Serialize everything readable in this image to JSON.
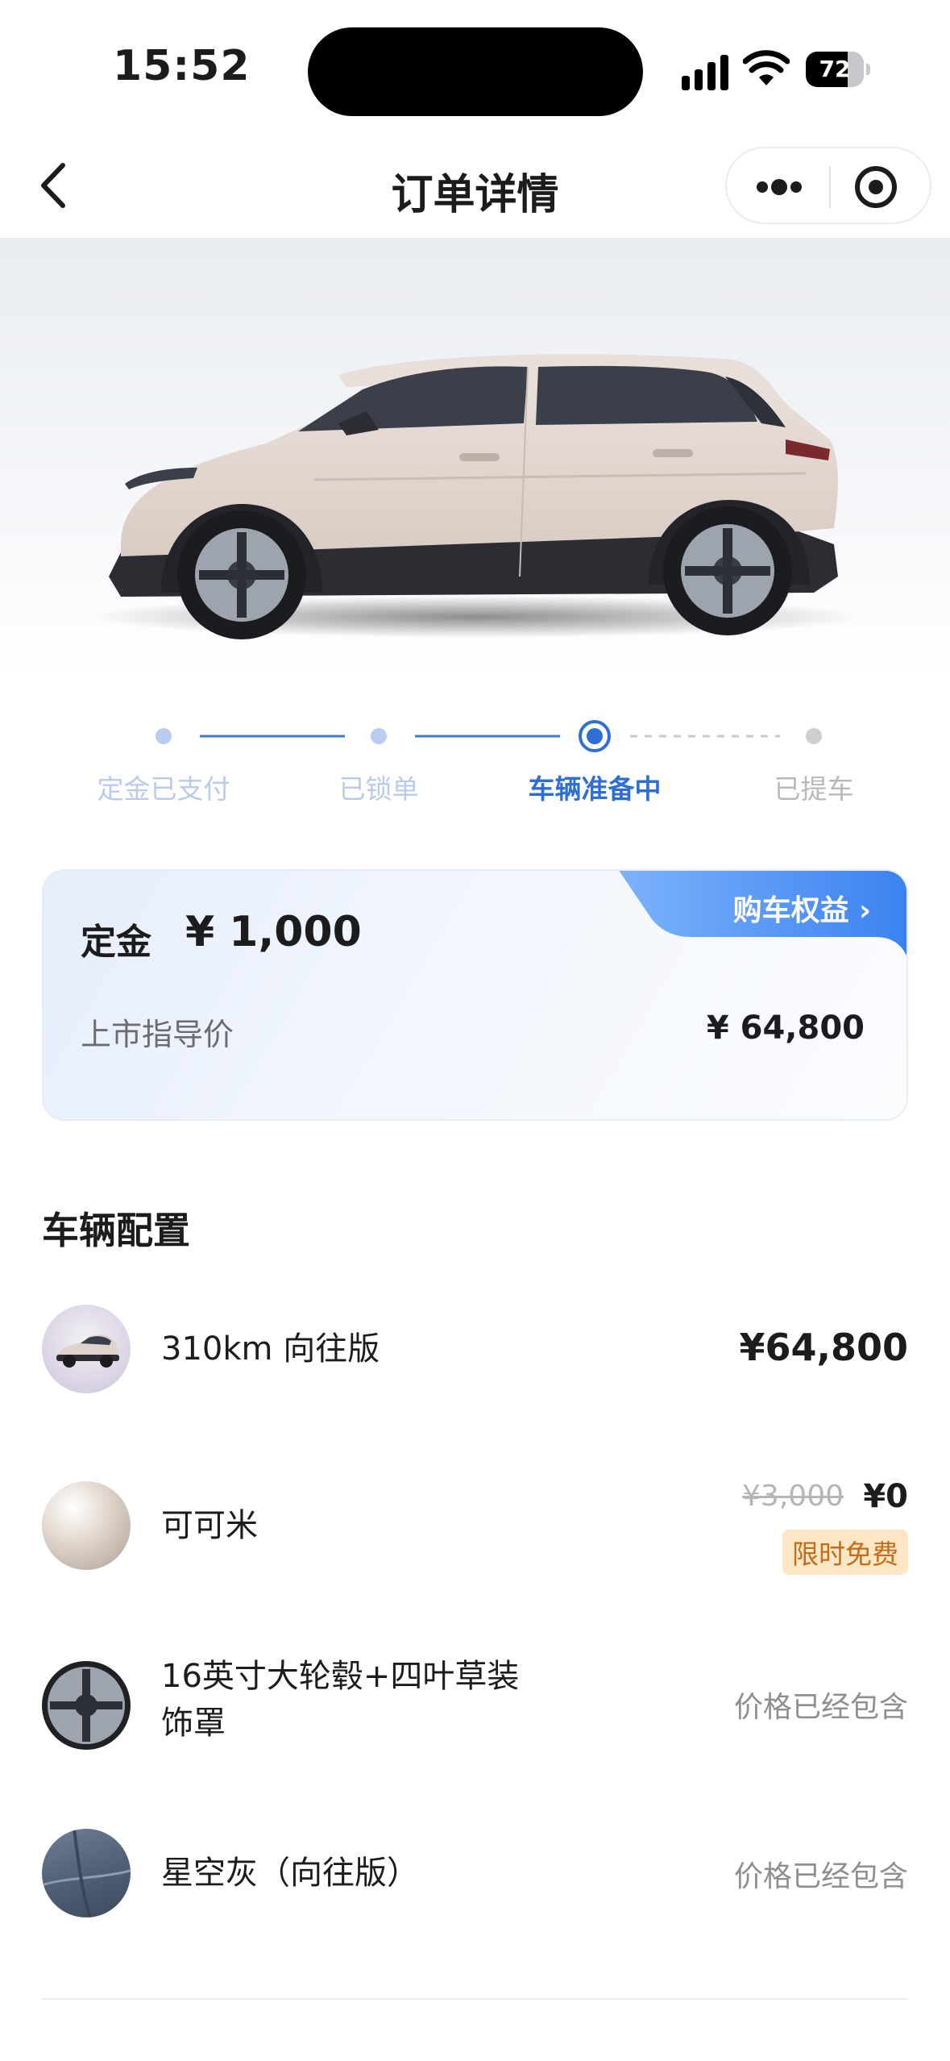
{
  "status_bar": {
    "time": "15:52",
    "battery": "72",
    "battery_level": 0.72
  },
  "nav": {
    "title": "订单详情"
  },
  "progress": {
    "steps": [
      {
        "label": "定金已支付",
        "state": "done"
      },
      {
        "label": "已锁单",
        "state": "done"
      },
      {
        "label": "车辆准备中",
        "state": "active"
      },
      {
        "label": "已提车",
        "state": "future"
      }
    ]
  },
  "price_card": {
    "badge": "购车权益 ›",
    "deposit_label": "定金",
    "deposit_value": "¥ 1,000",
    "msrp_label": "上市指导价",
    "msrp_value": "¥ 64,800"
  },
  "config": {
    "title": "车辆配置",
    "items": [
      {
        "name": "310km 向往版",
        "price": "¥64,800"
      },
      {
        "name": "可可米",
        "old_price": "¥3,000",
        "price": "¥0",
        "tag": "限时免费"
      },
      {
        "name_line1": "16英寸大轮毂+四叶草装",
        "name_line2": "饰罩",
        "note": "价格已经包含"
      },
      {
        "name": "星空灰（向往版）",
        "note": "价格已经包含"
      }
    ]
  },
  "colors": {
    "accent": "#2f6fd3",
    "badge": "#4f8ff5",
    "free_tag_bg": "#fde7c4",
    "free_tag_text": "#c56b1a"
  }
}
